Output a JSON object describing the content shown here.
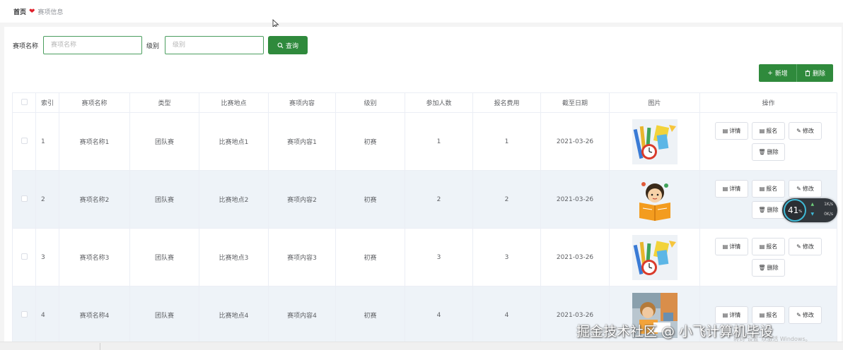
{
  "breadcrumb": {
    "home": "首页",
    "current": "赛项信息"
  },
  "search": {
    "name_label": "赛项名称",
    "name_placeholder": "赛项名称",
    "level_label": "级别",
    "level_placeholder": "级别",
    "query_button": "查询"
  },
  "toolbar": {
    "add_label": "新增",
    "delete_label": "删除"
  },
  "colors": {
    "primary": "#2f8a3c",
    "input_border": "#4b9e5f",
    "row_alt": "#eef3f8",
    "heart": "#e0202b"
  },
  "table": {
    "columns": [
      "索引",
      "赛项名称",
      "类型",
      "比赛地点",
      "赛项内容",
      "级别",
      "参加人数",
      "报名费用",
      "截至日期",
      "图片",
      "操作"
    ],
    "rows": [
      {
        "index": "1",
        "name": "赛项名称1",
        "type": "团队赛",
        "location": "比赛地点1",
        "content": "赛项内容1",
        "level": "初赛",
        "participants": "1",
        "fee": "1",
        "deadline": "2021-03-26",
        "image": "stationery-clock-image"
      },
      {
        "index": "2",
        "name": "赛项名称2",
        "type": "团队赛",
        "location": "比赛地点2",
        "content": "赛项内容2",
        "level": "初赛",
        "participants": "2",
        "fee": "2",
        "deadline": "2021-03-26",
        "image": "reading-child-image"
      },
      {
        "index": "3",
        "name": "赛项名称3",
        "type": "团队赛",
        "location": "比赛地点3",
        "content": "赛项内容3",
        "level": "初赛",
        "participants": "3",
        "fee": "3",
        "deadline": "2021-03-26",
        "image": "stationery-clock-image"
      },
      {
        "index": "4",
        "name": "赛项名称4",
        "type": "团队赛",
        "location": "比赛地点4",
        "content": "赛项内容4",
        "level": "初赛",
        "participants": "4",
        "fee": "4",
        "deadline": "2021-03-26",
        "image": "classroom-photo-image"
      }
    ],
    "actions": {
      "detail": "详情",
      "signup": "报名",
      "edit": "修改",
      "delete": "删除"
    }
  },
  "speed_widget": {
    "percent": "41",
    "unit": "%",
    "up": "1",
    "down": "0",
    "rate_unit": "K/s"
  },
  "watermark": "掘金技术社区 @ 小飞计算机毕设",
  "activate_text": "转到\"设置\"以激活 Windows。"
}
